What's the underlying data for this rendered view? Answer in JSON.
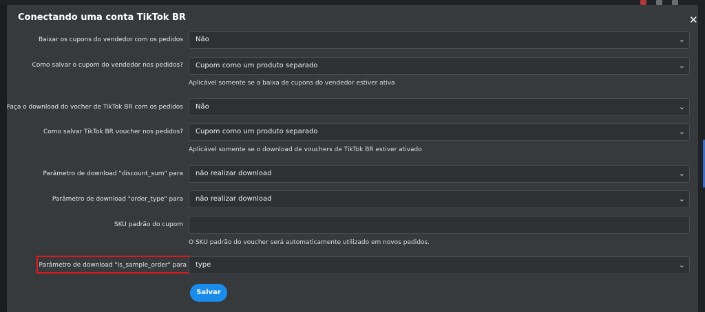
{
  "dialog": {
    "title": "Conectando uma conta TikTok BR",
    "close_icon": "close-icon"
  },
  "fields": [
    {
      "label": "Baixar os cupons do vendedor com os pedidos",
      "value": "Não"
    },
    {
      "label": "Como salvar o cupom do vendedor nos pedidos?",
      "value": "Cupom como um produto separado",
      "help": "Aplicável somente se a baixa de cupons do vendedor estiver ativa"
    },
    {
      "label": "Faça o download do vocher de TikTok BR com os pedidos",
      "value": "Não"
    },
    {
      "label": "Como salvar TikTok BR voucher nos pedidos?",
      "value": "Cupom como um produto separado",
      "help": "Aplicável somente se o download de vouchers de TikTok BR estiver ativado"
    },
    {
      "label": "Parâmetro de download \"discount_sum\" para",
      "value": "não realizar download"
    },
    {
      "label": "Parâmetro de download \"order_type\" para",
      "value": "não realizar download"
    },
    {
      "label": "SKU padrão do cupom",
      "value": "",
      "help": "O SKU padrão do voucher será automaticamente utilizado em novos pedidos."
    },
    {
      "label": "Parâmetro de download \"is_sample_order\" para",
      "value": "type"
    }
  ],
  "save_label": "Salvar",
  "colors": {
    "accent": "#1a8ceb",
    "highlight": "#e0171c",
    "background": "#373a3d"
  }
}
